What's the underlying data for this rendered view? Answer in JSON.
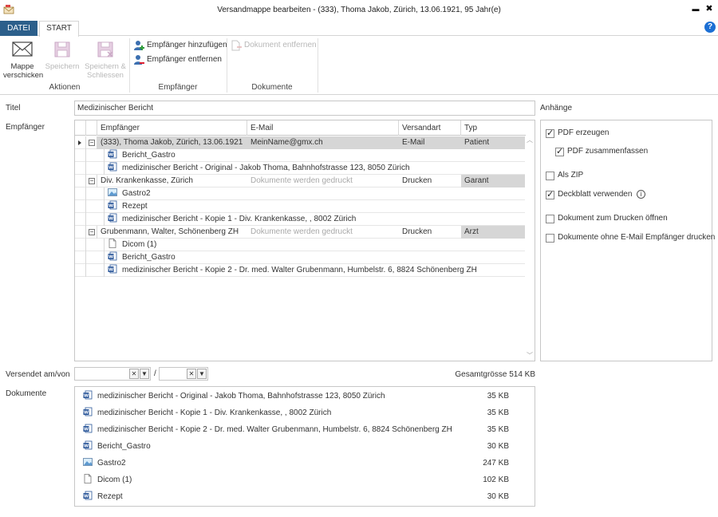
{
  "window": {
    "title": "Versandmappe bearbeiten - (333), Thoma Jakob, Zürich, 13.06.1921, 95 Jahr(e)"
  },
  "tabs": {
    "datei": "DATEI",
    "start": "START"
  },
  "ribbon": {
    "aktionen": {
      "label": "Aktionen",
      "mappe_line1": "Mappe",
      "mappe_line2": "verschicken",
      "speichern": "Speichern",
      "speichern_s1": "Speichern &",
      "speichern_s2": "Schliessen"
    },
    "empfaenger": {
      "label": "Empfänger",
      "add": "Empfänger hinzufügen",
      "remove": "Empfänger entfernen"
    },
    "dokumente": {
      "label": "Dokumente",
      "remove": "Dokument entfernen"
    }
  },
  "form": {
    "titel_label": "Titel",
    "titel_value": "Medizinischer Bericht",
    "empfaenger_label": "Empfänger",
    "anhaenge_label": "Anhänge",
    "versendet_label": "Versendet am/von",
    "slash": "/",
    "gesamt": "Gesamtgrösse 514 KB",
    "dokumente_label": "Dokumente"
  },
  "grid": {
    "headers": {
      "empfaenger": "Empfänger",
      "email": "E-Mail",
      "versandart": "Versandart",
      "typ": "Typ"
    },
    "recipients": [
      {
        "name": "(333), Thoma Jakob, Zürich, 13.06.1921",
        "email": "MeinName@gmx.ch",
        "versandart": "E-Mail",
        "typ": "Patient",
        "docs": [
          {
            "icon": "word",
            "name": "Bericht_Gastro"
          },
          {
            "icon": "word",
            "name": "medizinischer Bericht - Original - Jakob Thoma, Bahnhofstrasse 123, 8050 Zürich"
          }
        ]
      },
      {
        "name": "Div. Krankenkasse, Zürich",
        "email": "Dokumente werden gedruckt",
        "versandart": "Drucken",
        "typ": "Garant",
        "docs": [
          {
            "icon": "image",
            "name": "Gastro2"
          },
          {
            "icon": "word",
            "name": "Rezept"
          },
          {
            "icon": "word",
            "name": "medizinischer Bericht - Kopie 1 - Div. Krankenkasse, , 8002 Zürich"
          }
        ]
      },
      {
        "name": "Grubenmann, Walter, Schönenberg ZH",
        "email": "Dokumente werden gedruckt",
        "versandart": "Drucken",
        "typ": "Arzt",
        "docs": [
          {
            "icon": "blank",
            "name": "Dicom (1)"
          },
          {
            "icon": "word",
            "name": "Bericht_Gastro"
          },
          {
            "icon": "word",
            "name": "medizinischer Bericht - Kopie 2 - Dr. med. Walter Grubenmann, Humbelstr. 6, 8824 Schönenberg ZH"
          }
        ]
      }
    ]
  },
  "attachments": {
    "pdf_erzeugen": {
      "label": "PDF erzeugen",
      "checked": true
    },
    "pdf_zusammen": {
      "label": "PDF zusammenfassen",
      "checked": true
    },
    "als_zip": {
      "label": "Als ZIP",
      "checked": false
    },
    "deckblatt": {
      "label": "Deckblatt verwenden",
      "checked": true
    },
    "drucken_oeffnen": {
      "label": "Dokument zum Drucken öffnen",
      "checked": false
    },
    "ohne_email": {
      "label": "Dokumente ohne E-Mail Empfänger drucken",
      "checked": false
    }
  },
  "documents": [
    {
      "icon": "word",
      "name": "medizinischer Bericht - Original - Jakob Thoma, Bahnhofstrasse 123, 8050 Zürich",
      "size": "35 KB"
    },
    {
      "icon": "word",
      "name": "medizinischer Bericht - Kopie 1 - Div. Krankenkasse, , 8002 Zürich",
      "size": "35 KB"
    },
    {
      "icon": "word",
      "name": "medizinischer Bericht - Kopie 2 - Dr. med. Walter Grubenmann, Humbelstr. 6, 8824 Schönenberg ZH",
      "size": "35 KB"
    },
    {
      "icon": "word",
      "name": "Bericht_Gastro",
      "size": "30 KB"
    },
    {
      "icon": "image",
      "name": "Gastro2",
      "size": "247 KB"
    },
    {
      "icon": "blank",
      "name": "Dicom (1)",
      "size": "102 KB"
    },
    {
      "icon": "word",
      "name": "Rezept",
      "size": "30 KB"
    }
  ],
  "colors": {
    "accent": "#2c5f8b",
    "help": "#1c6fd4",
    "word_icon": "#2b579a",
    "row_highlight": "#d6d6d6"
  }
}
